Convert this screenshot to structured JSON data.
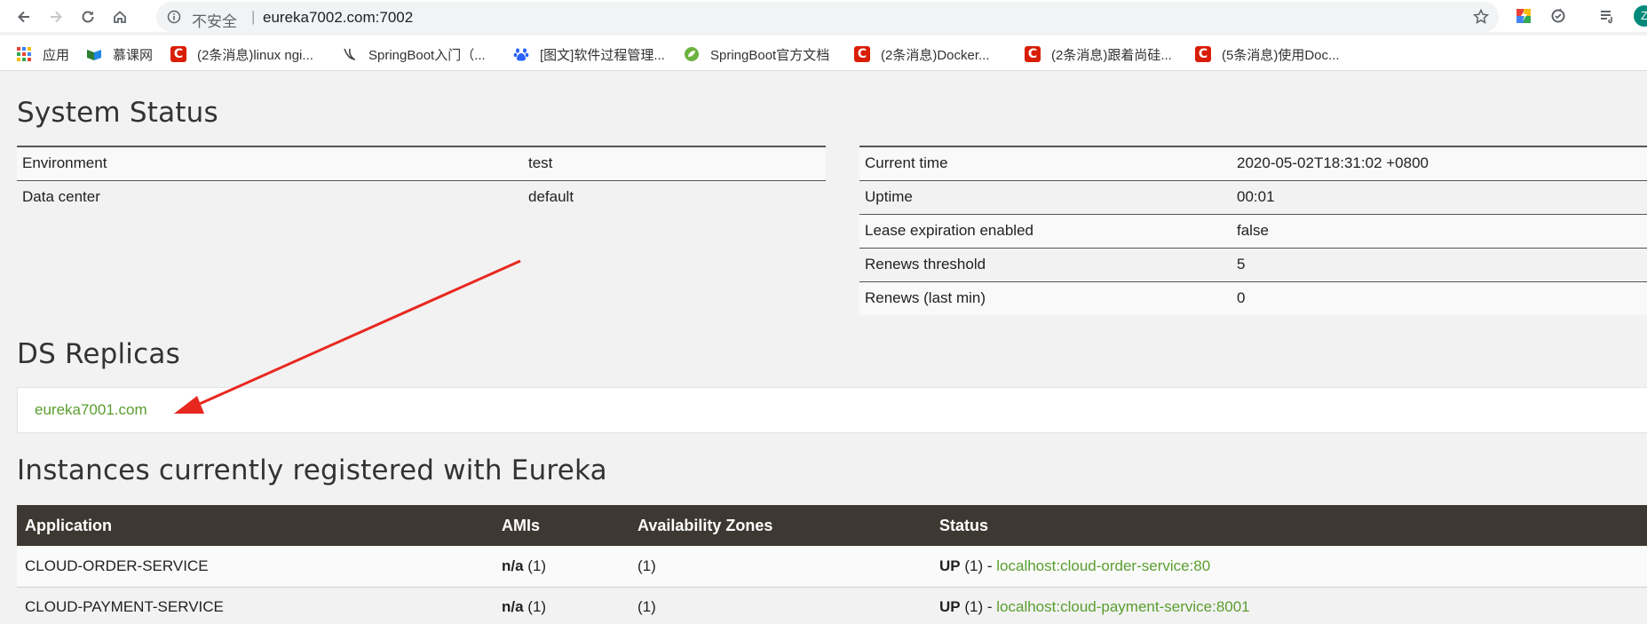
{
  "browser": {
    "security_label": "不安全",
    "separator": "|",
    "url": "eureka7002.com:7002",
    "profile_initial": "Z",
    "bookmarks": [
      {
        "label": "应用",
        "icon": "apps-grid-icon"
      },
      {
        "label": "慕课网",
        "icon": "imooc-icon"
      },
      {
        "label": "(2条消息)linux ngi...",
        "icon": "csdn-icon"
      },
      {
        "label": "SpringBoot入门（...",
        "icon": "bookmark-icon"
      },
      {
        "label": "[图文]软件过程管理...",
        "icon": "baidu-paw-icon"
      },
      {
        "label": "SpringBoot官方文档",
        "icon": "spring-leaf-icon"
      },
      {
        "label": "(2条消息)Docker...",
        "icon": "csdn-icon"
      },
      {
        "label": "(2条消息)跟着尚硅...",
        "icon": "csdn-icon"
      },
      {
        "label": "(5条消息)使用Doc...",
        "icon": "csdn-icon"
      }
    ],
    "csdn_letter": "C"
  },
  "system_status": {
    "title": "System Status",
    "left": [
      {
        "key": "Environment",
        "value": "test"
      },
      {
        "key": "Data center",
        "value": "default"
      }
    ],
    "right": [
      {
        "key": "Current time",
        "value": "2020-05-02T18:31:02 +0800"
      },
      {
        "key": "Uptime",
        "value": "00:01"
      },
      {
        "key": "Lease expiration enabled",
        "value": "false"
      },
      {
        "key": "Renews threshold",
        "value": "5"
      },
      {
        "key": "Renews (last min)",
        "value": "0"
      }
    ]
  },
  "replicas": {
    "title": "DS Replicas",
    "items": [
      "eureka7001.com"
    ]
  },
  "instances": {
    "title": "Instances currently registered with Eureka",
    "headers": [
      "Application",
      "AMIs",
      "Availability Zones",
      "Status"
    ],
    "rows": [
      {
        "application": "CLOUD-ORDER-SERVICE",
        "ami": "n/a",
        "ami_count": "(1)",
        "zones": "(1)",
        "status": "UP",
        "status_count": "(1) -",
        "link": "localhost:cloud-order-service:80"
      },
      {
        "application": "CLOUD-PAYMENT-SERVICE",
        "ami": "n/a",
        "ami_count": "(1)",
        "zones": "(1)",
        "status": "UP",
        "status_count": "(1) -",
        "link": "localhost:cloud-payment-service:8001"
      }
    ]
  },
  "colors": {
    "link_green": "#5a9e2f",
    "header_dark": "#3d3831",
    "annotation_red": "#e8281f"
  }
}
